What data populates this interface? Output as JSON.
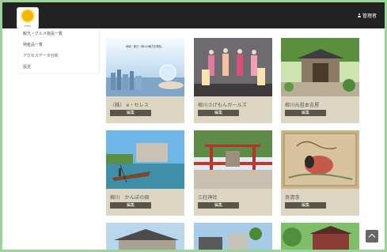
{
  "header": {
    "logo_name": "sun-logo",
    "logo_caption": "EXEZ",
    "user_label": "管理者",
    "bg_color": "#222222"
  },
  "sidebar": {
    "items": [
      {
        "label": "観光・グルメ施設一覧"
      },
      {
        "label": "特産品一覧"
      },
      {
        "label": "アクセスデータ分析"
      },
      {
        "label": "設定"
      }
    ]
  },
  "cards": [
    {
      "title": "（株） e・セレス",
      "button": "編集",
      "photo_text": "地域・旅行・柳川の魅力を発信。"
    },
    {
      "title": "柳川さげもんガールズ",
      "button": "編集"
    },
    {
      "title": "柳川元祖本吉屋",
      "button": "編集"
    },
    {
      "title": "柳川　かんぽの宿",
      "button": "編集"
    },
    {
      "title": "三柱神社",
      "button": "編集"
    },
    {
      "title": "良清寺",
      "button": "編集"
    },
    {
      "title": "",
      "button": ""
    },
    {
      "title": "",
      "button": ""
    },
    {
      "title": "",
      "button": ""
    }
  ],
  "colors": {
    "card_bg": "#ddd6c2",
    "button_bg": "#595548",
    "page_border": "#9bd39a"
  }
}
